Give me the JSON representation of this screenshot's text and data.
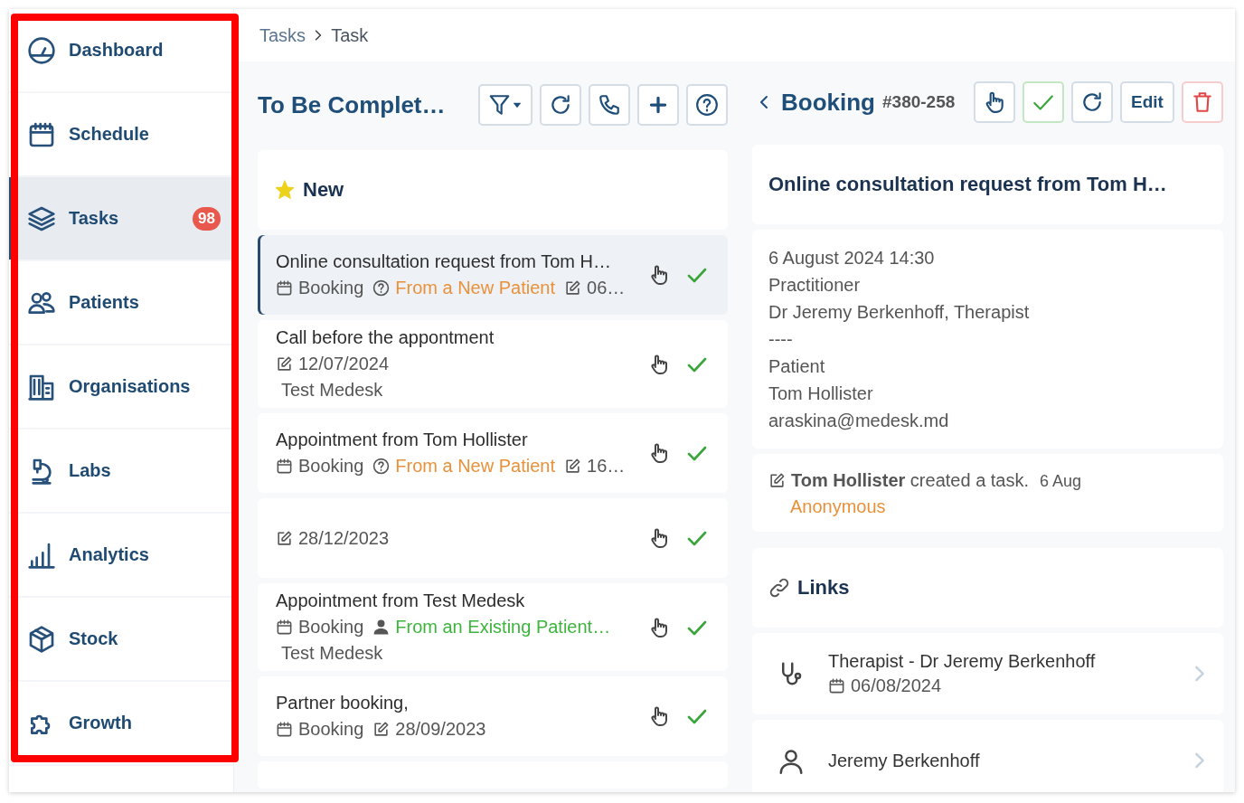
{
  "sidebar": {
    "items": [
      {
        "label": "Dashboard",
        "selected": false
      },
      {
        "label": "Schedule",
        "selected": false
      },
      {
        "label": "Tasks",
        "selected": true,
        "badge": "98"
      },
      {
        "label": "Patients",
        "selected": false
      },
      {
        "label": "Organisations",
        "selected": false
      },
      {
        "label": "Labs",
        "selected": false
      },
      {
        "label": "Analytics",
        "selected": false
      },
      {
        "label": "Stock",
        "selected": false
      },
      {
        "label": "Growth",
        "selected": false
      }
    ]
  },
  "breadcrumb": [
    "Tasks",
    "Task"
  ],
  "task_list": {
    "title": "To Be Complet…",
    "group": "New",
    "rows": [
      {
        "title": "Online consultation request from Tom H…",
        "selected": true,
        "meta": [
          {
            "kind": "booking",
            "text": "Booking"
          },
          {
            "kind": "query",
            "text": "From a New Patient",
            "color": "#e8913a"
          },
          {
            "kind": "edited",
            "text": "06…"
          }
        ]
      },
      {
        "title": "Call before the appontment",
        "selected": false,
        "meta": [
          {
            "kind": "edited",
            "text": "12/07/2024"
          }
        ],
        "note": "Test Medesk"
      },
      {
        "title": "Appointment from Tom Hollister",
        "selected": false,
        "meta": [
          {
            "kind": "booking",
            "text": "Booking"
          },
          {
            "kind": "query",
            "text": "From a New Patient",
            "color": "#e8913a"
          },
          {
            "kind": "edited",
            "text": "16…"
          }
        ]
      },
      {
        "selected": false,
        "meta": [
          {
            "kind": "edited",
            "text": "28/12/2023"
          }
        ]
      },
      {
        "title": "Appointment from Test Medesk",
        "selected": false,
        "meta": [
          {
            "kind": "booking",
            "text": "Booking"
          },
          {
            "kind": "patient",
            "text": "From an Existing Patient…",
            "color": "#3db53d"
          }
        ],
        "note": "Test Medesk"
      },
      {
        "title": "Partner booking,",
        "selected": false,
        "meta": [
          {
            "kind": "booking",
            "text": "Booking"
          },
          {
            "kind": "edited",
            "text": "28/09/2023"
          }
        ]
      }
    ]
  },
  "detail": {
    "type": "Booking",
    "number": "#380-258",
    "edit_label": "Edit",
    "title": "Online consultation request from Tom H…",
    "lines": [
      "6 August 2024 14:30",
      "Practitioner",
      "Dr Jeremy Berkenhoff, Therapist",
      "----",
      "Patient",
      "Tom Hollister",
      "araskina@medesk.md"
    ],
    "activity": {
      "text": "**Tom Hollister** created a task.",
      "time": "6 Aug",
      "source": "Anonymous"
    },
    "links_title": "Links",
    "links": [
      {
        "kind": "practitioner",
        "title": "Therapist - Dr Jeremy Berkenhoff",
        "date": "06/08/2024"
      },
      {
        "kind": "user",
        "title": "Jeremy Berkenhoff"
      }
    ]
  }
}
